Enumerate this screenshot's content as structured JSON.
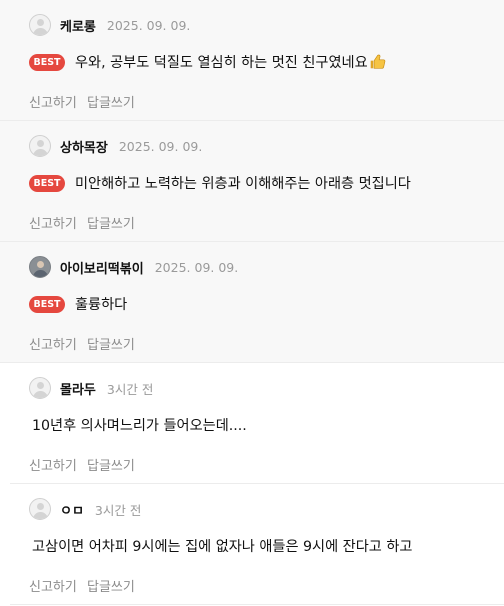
{
  "report_label": "신고하기",
  "reply_label": "답글쓰기",
  "best_label": "BEST",
  "comments": [
    {
      "nickname": "케로롱",
      "date": "2025. 09. 09.",
      "text": "우와, 공부도 덕질도 열심히 하는 멋진 친구였네요",
      "emoji": "thumbs-up",
      "best": true,
      "avatar": "default-avatar-icon"
    },
    {
      "nickname": "상하목장",
      "date": "2025. 09. 09.",
      "text": "미안해하고 노력하는 위층과 이해해주는 아래층 멋집니다",
      "best": true,
      "avatar": "default-avatar-icon"
    },
    {
      "nickname": "아이보리떡볶이",
      "date": "2025. 09. 09.",
      "text": "훌륭하다",
      "best": true,
      "avatar": "profile-photo"
    },
    {
      "nickname": "몰라두",
      "date": "3시간 전",
      "text": "10년후 의사며느리가 들어오는데....",
      "best": false,
      "avatar": "default-avatar-icon"
    },
    {
      "nickname": "ㅇㅁ",
      "date": "3시간 전",
      "text": "고삼이면 어차피 9시에는 집에 없자나 애들은 9시에 잔다고 하고",
      "best": false,
      "avatar": "default-avatar-icon"
    }
  ],
  "colors": {
    "best_badge": "#e5483f",
    "best_background": "#f8f8f8",
    "meta_text": "#9a9a9a"
  }
}
